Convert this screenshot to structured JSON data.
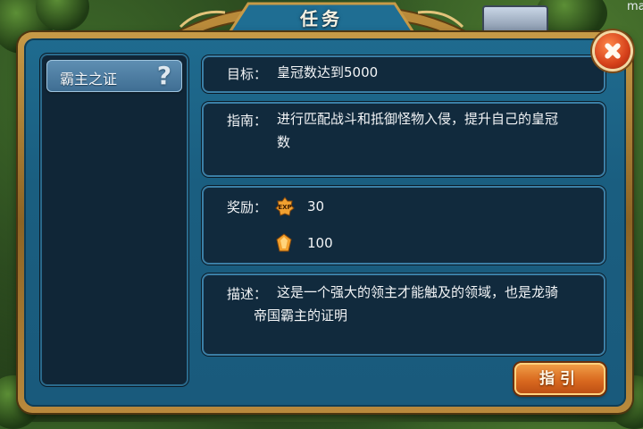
{
  "window": {
    "title": "任务",
    "corner_text": "ma"
  },
  "sidebar": {
    "items": [
      {
        "label": "霸主之证",
        "help_icon": "?"
      }
    ]
  },
  "objective": {
    "label": "目标：",
    "text": "皇冠数达到5000"
  },
  "guide": {
    "label": "指南：",
    "text_line1": "进行匹配战斗和抵御怪物入侵，提升自己的皇冠",
    "text_line2": "数"
  },
  "rewards": {
    "label": "奖励：",
    "items": [
      {
        "icon": "exp-icon",
        "value": "30"
      },
      {
        "icon": "gem-icon",
        "value": "100"
      }
    ]
  },
  "description": {
    "label": "描述：",
    "text_line1": "这是一个强大的领主才能触及的领域，也是龙骑",
    "text_line2": "帝国霸主的证明"
  },
  "buttons": {
    "guide_label": "指引",
    "close_icon": "close-icon"
  }
}
